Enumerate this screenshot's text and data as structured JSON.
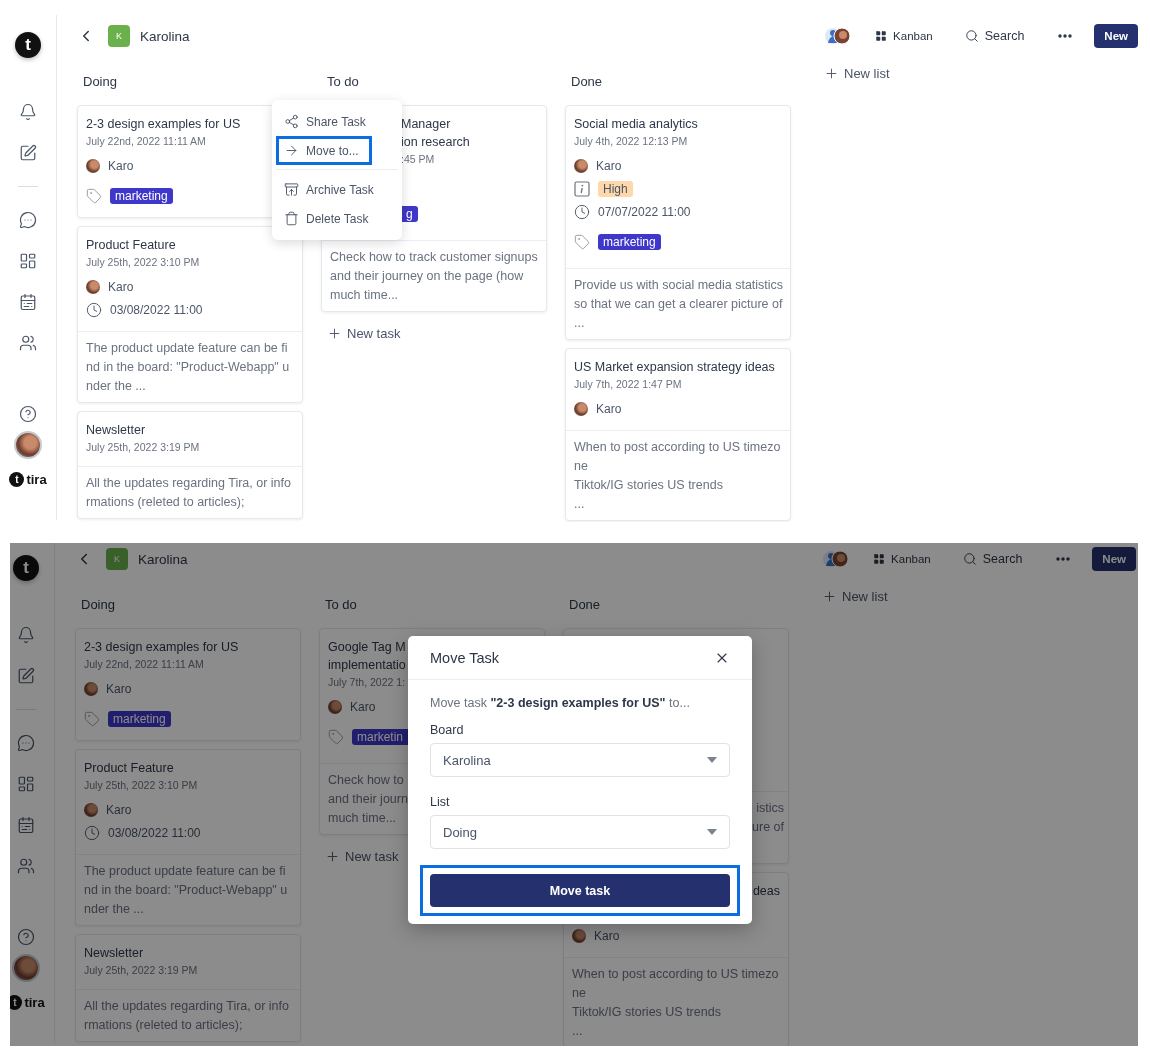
{
  "screens": [
    {
      "sidebar": {
        "logo": "t",
        "brand": {
          "mark": "t",
          "name": "tira"
        }
      },
      "header": {
        "board_initial": "K",
        "board_name": "Karolina",
        "view": "Kanban",
        "search": "Search",
        "new_button": "New"
      },
      "columns": [
        {
          "title": "Doing",
          "cards": [
            {
              "kind": "full",
              "title": "2-3 design examples for US",
              "date": "July 22nd, 2022 11:11 AM",
              "assignee": "Karo",
              "tags": [
                "marketing"
              ]
            },
            {
              "kind": "full",
              "title": "Product Feature",
              "date": "July 25th, 2022 3:10 PM",
              "assignee": "Karo",
              "due": "03/08/2022 11:00",
              "description": "The product update feature can be find in the board: \"Product-Webapp\" under the ..."
            },
            {
              "kind": "full",
              "title": "Newsletter",
              "date": "July 25th, 2022 3:19 PM",
              "description": "All the updates regarding Tira, or informations (releted to articles);"
            }
          ]
        },
        {
          "title": "To do",
          "new_task": "New task",
          "cards": [
            {
              "kind": "covered_left",
              "title": "Manager\nion research",
              "date": ":45 PM",
              "tags": [
                "g"
              ],
              "description": [
                "Check how to track customer signups",
                "and their journey on the page (how",
                "much time..."
              ]
            }
          ]
        },
        {
          "title": "Done",
          "cards": [
            {
              "kind": "full",
              "title": "Social media analytics",
              "date": "July 4th, 2022 12:13 PM",
              "assignee": "Karo",
              "priority": "High",
              "due": "07/07/2022 11:00",
              "tags": [
                "marketing"
              ],
              "description": [
                "Provide us with social media statistics",
                "so that we can get a clearer picture of",
                "..."
              ]
            },
            {
              "kind": "full",
              "title": "US Market expansion strategy ideas",
              "date": "July 7th, 2022 1:47 PM",
              "assignee": "Karo",
              "description": "When to post according to US timezone\nTiktok/IG stories US trends\n..."
            }
          ]
        }
      ],
      "new_list": "New list",
      "context_menu": {
        "groups": [
          [
            {
              "kind": "share",
              "label": "Share Task",
              "highlighted": false
            },
            {
              "kind": "move",
              "label": "Move to...",
              "highlighted": true
            }
          ],
          [
            {
              "kind": "archive",
              "label": "Archive Task",
              "highlighted": false
            },
            {
              "kind": "delete",
              "label": "Delete Task",
              "highlighted": false
            }
          ]
        ]
      }
    },
    {
      "sidebar": {
        "logo": "t",
        "brand": {
          "mark": "t",
          "name": "tira"
        }
      },
      "header": {
        "board_initial": "K",
        "board_name": "Karolina",
        "view": "Kanban",
        "search": "Search",
        "new_button": "New"
      },
      "columns": [
        {
          "title": "Doing",
          "cards": [
            {
              "kind": "full",
              "title": "2-3 design examples for US",
              "date": "July 22nd, 2022 11:11 AM",
              "assignee": "Karo",
              "tags": [
                "marketing"
              ]
            },
            {
              "kind": "full",
              "title": "Product Feature",
              "date": "July 25th, 2022 3:10 PM",
              "assignee": "Karo",
              "due": "03/08/2022 11:00",
              "description": "The product update feature can be find in the board: \"Product-Webapp\" under the ..."
            },
            {
              "kind": "full",
              "title": "Newsletter",
              "date": "July 25th, 2022 3:19 PM",
              "description": "All the updates regarding Tira, or informations (releted to articles);"
            }
          ]
        },
        {
          "title": "To do",
          "new_task": "New task",
          "cards": [
            {
              "kind": "covered_right",
              "title": "Google Tag M\nimplementatio",
              "date": "July 7th, 2022 1:",
              "assignee": "Karo",
              "tags": [
                "marketin"
              ],
              "description": [
                "Check how to",
                "and their journ",
                "much time..."
              ]
            }
          ]
        },
        {
          "title": "Done",
          "cards": [
            {
              "kind": "covered_top",
              "description": [
                "istics",
                "ure of"
              ]
            },
            {
              "kind": "covered_title",
              "title": "deas",
              "assignee": "Karo",
              "description": "When to post according to US timezone\nTiktok/IG stories US trends\n..."
            }
          ]
        }
      ],
      "new_list": "New list",
      "dialog": {
        "title": "Move Task",
        "message": "Move task **\"2-3 design examples for US\"** to...",
        "fields": [
          {
            "label": "Board",
            "value": "Karolina"
          },
          {
            "label": "List",
            "value": "Doing"
          }
        ],
        "button": {
          "label": "Move task",
          "highlighted": true
        }
      }
    }
  ]
}
